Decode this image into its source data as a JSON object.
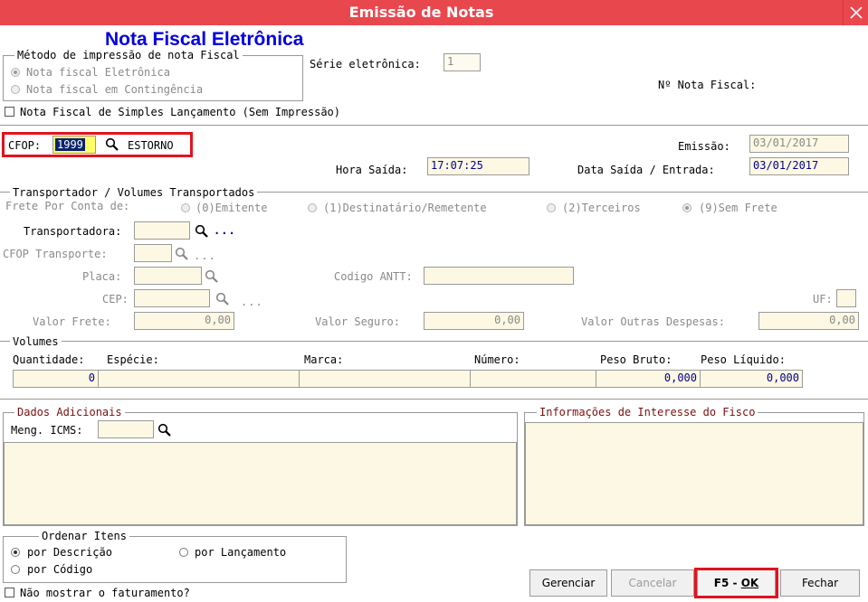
{
  "window": {
    "title": "Emissão de Notas"
  },
  "header": {
    "heading": "Nota Fiscal Eletrônica",
    "metodo_legend": "Método de impressão de nota Fiscal",
    "metodo_options": [
      "Nota fiscal Eletrônica",
      "Nota fiscal em Contingência"
    ],
    "serie_label": "Série eletrônica:",
    "serie_value": "1",
    "numero_label": "Nº Nota Fiscal:",
    "simples_label": "Nota Fiscal de Simples Lançamento (Sem Impressão)"
  },
  "cfop": {
    "label": "CFOP:",
    "value": "1999",
    "description": "ESTORNO",
    "emissao_label": "Emissão:",
    "emissao_value": "03/01/2017",
    "hora_label": "Hora Saída:",
    "hora_value": "17:07:25",
    "data_label": "Data Saída / Entrada:",
    "data_value": "03/01/2017"
  },
  "transporte": {
    "legend": "Transportador /  Volumes Transportados",
    "frete_label": "Frete Por Conta de:",
    "frete_options": [
      "(0)Emitente",
      "(1)Destinatário/Remetente",
      "(2)Terceiros",
      "(9)Sem Frete"
    ],
    "transportadora_label": "Transportadora:",
    "cfop_transporte_label": "CFOP Transporte:",
    "placa_label": "Placa:",
    "antt_label": "Codigo ANTT:",
    "cep_label": "CEP:",
    "uf_label": "UF:",
    "valor_frete_label": "Valor Frete:",
    "valor_frete_value": "0,00",
    "valor_seguro_label": "Valor Seguro:",
    "valor_seguro_value": "0,00",
    "valor_outras_label": "Valor Outras Despesas:",
    "valor_outras_value": "0,00",
    "ellipsis": "..."
  },
  "volumes": {
    "legend": "Volumes",
    "quantidade_label": "Quantidade:",
    "quantidade_value": "0",
    "especie_label": "Espécie:",
    "marca_label": "Marca:",
    "numero_label": "Número:",
    "peso_bruto_label": "Peso Bruto:",
    "peso_bruto_value": "0,000",
    "peso_liquido_label": "Peso Líquido:",
    "peso_liquido_value": "0,000"
  },
  "adicionais": {
    "legend": "Dados Adicionais",
    "icms_label": "Meng. ICMS:",
    "fisco_legend": "Informações de Interesse do Fisco"
  },
  "ordenar": {
    "legend": "Ordenar Itens",
    "options": [
      "por Descrição",
      "por Lançamento",
      "por Código"
    ]
  },
  "footer": {
    "nao_mostrar_label": "Não mostrar o faturamento?",
    "gerenciar_label": "Gerenciar",
    "cancelar_label": "Cancelar",
    "ok_key": "F5",
    "ok_sep": " - ",
    "ok_label": "OK",
    "fechar_label": "Fechar"
  },
  "colors": {
    "title_bar": "#e9474e",
    "highlight_box": "#e0141e",
    "heading_blue": "#0000e0",
    "field_bg": "#fdf8e4"
  }
}
